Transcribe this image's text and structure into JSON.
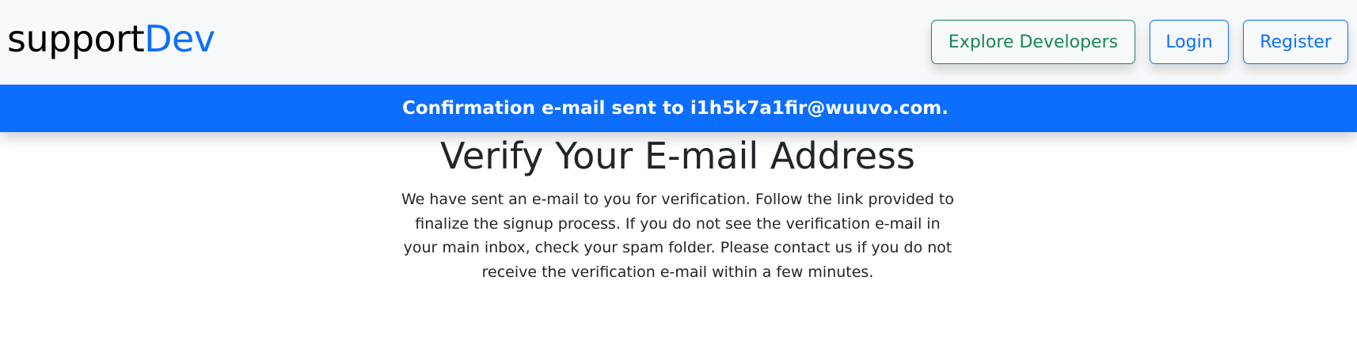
{
  "navbar": {
    "brand_prefix": "support",
    "brand_accent": "Dev",
    "buttons": {
      "explore": "Explore Developers",
      "login": "Login",
      "register": "Register"
    }
  },
  "alert": {
    "message": "Confirmation e-mail sent to i1h5k7a1fir@wuuvo.com."
  },
  "main": {
    "title": "Verify Your E-mail Address",
    "body": "We have sent an e-mail to you for verification. Follow the link provided to finalize the signup process. If you do not see the verification e-mail in your main inbox, check your spam folder. Please contact us if you do not receive the verification e-mail within a few minutes."
  },
  "colors": {
    "primary": "#0d6efd",
    "success": "#198754",
    "navbar_bg": "#f8f9fa",
    "text": "#212529"
  }
}
